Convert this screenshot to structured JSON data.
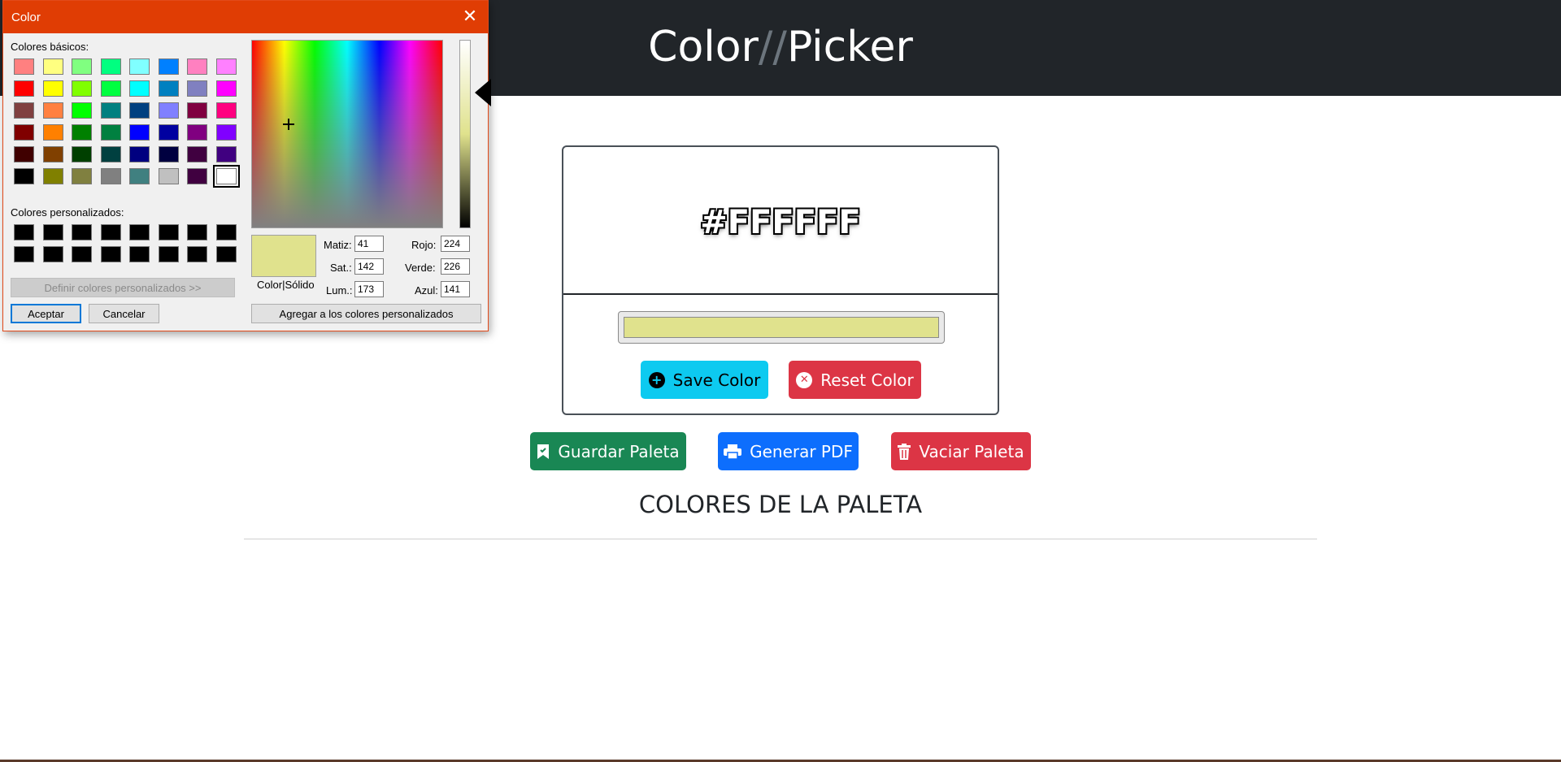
{
  "header": {
    "brand_part1": "Color",
    "brand_sep": "//",
    "brand_part2": "Picker"
  },
  "card": {
    "hex_value": "#FFFFFF",
    "input_color": "#e0e28d",
    "save_label": "Save Color",
    "reset_label": "Reset Color"
  },
  "actions": {
    "guardar_label": "Guardar Paleta",
    "pdf_label": "Generar PDF",
    "vaciar_label": "Vaciar Paleta"
  },
  "section": {
    "title": "COLORES DE LA PALETA"
  },
  "dialog": {
    "title": "Color",
    "basic_label": "Colores básicos:",
    "custom_label": "Colores personalizados:",
    "define_label": "Definir colores personalizados >>",
    "accept_label": "Aceptar",
    "cancel_label": "Cancelar",
    "add_custom_label": "Agregar a los colores personalizados",
    "color_solid_label": "Color|Sólido",
    "matiz_label": "Matiz:",
    "matiz": "41",
    "sat_label": "Sat.:",
    "sat": "142",
    "lum_label": "Lum.:",
    "lum": "173",
    "rojo_label": "Rojo:",
    "rojo": "224",
    "verde_label": "Verde:",
    "verde": "226",
    "azul_label": "Azul:",
    "azul": "141",
    "preview_color": "#e0e28d",
    "basic_colors": [
      [
        "#ff8080",
        "#ffff80",
        "#80ff80",
        "#00ff80",
        "#80ffff",
        "#0080ff",
        "#ff80c0",
        "#ff80ff"
      ],
      [
        "#ff0000",
        "#ffff00",
        "#80ff00",
        "#00ff40",
        "#00ffff",
        "#0080c0",
        "#8080c0",
        "#ff00ff"
      ],
      [
        "#804040",
        "#ff8040",
        "#00ff00",
        "#008080",
        "#004080",
        "#8080ff",
        "#800040",
        "#ff0080"
      ],
      [
        "#800000",
        "#ff8000",
        "#008000",
        "#008040",
        "#0000ff",
        "#0000a0",
        "#800080",
        "#8000ff"
      ],
      [
        "#400000",
        "#804000",
        "#004000",
        "#004040",
        "#000080",
        "#000040",
        "#400040",
        "#400080"
      ],
      [
        "#000000",
        "#808000",
        "#808040",
        "#808080",
        "#408080",
        "#c0c0c0",
        "#400040",
        "#ffffff"
      ]
    ],
    "custom_colors": [
      [
        "#000000",
        "#000000",
        "#000000",
        "#000000",
        "#000000",
        "#000000",
        "#000000",
        "#000000"
      ],
      [
        "#000000",
        "#000000",
        "#000000",
        "#000000",
        "#000000",
        "#000000",
        "#000000",
        "#000000"
      ]
    ]
  }
}
